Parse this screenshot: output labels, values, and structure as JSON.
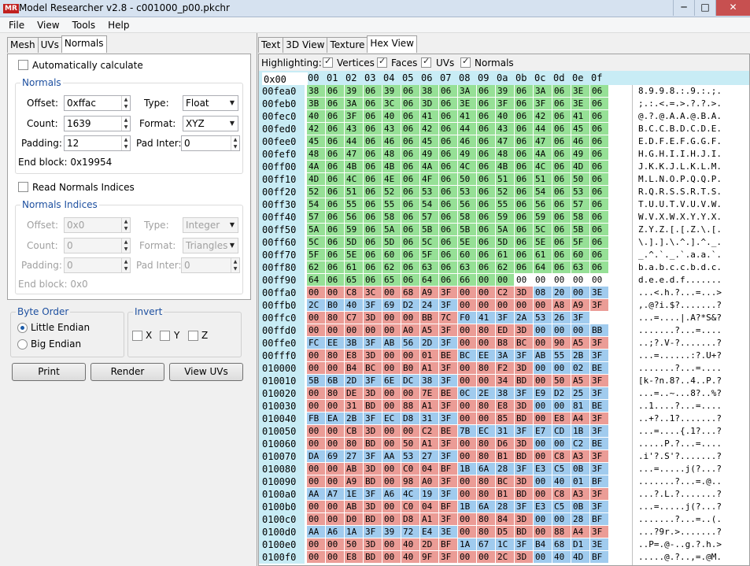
{
  "window": {
    "title": "Model Researcher v2.8 - c001000_p00.pkchr",
    "icon_text": "MR",
    "controls": [
      "─",
      "□",
      "✕"
    ]
  },
  "menu": [
    "File",
    "View",
    "Tools",
    "Help"
  ],
  "left_tabs": [
    "Mesh",
    "UVs",
    "Normals"
  ],
  "normals_tab": {
    "auto_calculate_label": "Automatically calculate",
    "auto_calculate_checked": false,
    "group_title": "Normals",
    "offset_label": "Offset:",
    "offset_value": "0xffac",
    "type_label": "Type:",
    "type_value": "Float",
    "count_label": "Count:",
    "count_value": "1639",
    "format_label": "Format:",
    "format_value": "XYZ",
    "padding_label": "Padding:",
    "padding_value": "12",
    "pad_inter_label": "Pad Inter:",
    "pad_inter_value": "0",
    "end_block_label": "End block: 0x19954",
    "read_indices_label": "Read Normals Indices",
    "read_indices_checked": false,
    "indices_group_title": "Normals Indices",
    "idx_offset_label": "Offset:",
    "idx_offset_value": "0x0",
    "idx_type_label": "Type:",
    "idx_type_value": "Integer",
    "idx_count_label": "Count:",
    "idx_count_value": "0",
    "idx_format_label": "Format:",
    "idx_format_value": "Triangles",
    "idx_padding_label": "Padding:",
    "idx_padding_value": "0",
    "idx_pad_inter_label": "Pad Inter:",
    "idx_pad_inter_value": "0",
    "idx_end_block_label": "End block: 0x0"
  },
  "byte_order": {
    "title": "Byte Order",
    "options": [
      "Little Endian",
      "Big Endian"
    ],
    "selected": "Little Endian"
  },
  "invert": {
    "title": "Invert",
    "options": [
      "X",
      "Y",
      "Z"
    ]
  },
  "buttons": [
    "Print",
    "Render",
    "View UVs"
  ],
  "right_tabs": [
    "Text",
    "3D View",
    "Texture",
    "Hex View"
  ],
  "active_right_tab": "Hex View",
  "highlighting": {
    "label": "Highlighting:",
    "options": [
      "Vertices",
      "Faces",
      "UVs",
      "Normals"
    ]
  },
  "hex_header": {
    "origin": "0x00",
    "columns": [
      "00",
      "01",
      "02",
      "03",
      "04",
      "05",
      "06",
      "07",
      "08",
      "09",
      "0a",
      "0b",
      "0c",
      "0d",
      "0e",
      "0f"
    ]
  },
  "hex_colors": {
    "g": "#96e096",
    "b": "#a0cbee",
    "r": "#eb9c96",
    "w": "#ffffff"
  },
  "hex_rows": [
    {
      "addr": "00fea0",
      "bytes": "38 06 39 06 39 06 38 06 3A 06 39 06 3A 06 3E 06",
      "colors": "gggggggggggggggg",
      "ascii": "8.9.9.8.:.9.:.;."
    },
    {
      "addr": "00feb0",
      "bytes": "3B 06 3A 06 3C 06 3D 06 3E 06 3F 06 3F 06 3E 06",
      "colors": "gggggggggggggggg",
      "ascii": ";.:.<.=.>.?.?.>."
    },
    {
      "addr": "00fec0",
      "bytes": "40 06 3F 06 40 06 41 06 41 06 40 06 42 06 41 06",
      "colors": "gggggggggggggggg",
      "ascii": "@.?.@.A.A.@.B.A."
    },
    {
      "addr": "00fed0",
      "bytes": "42 06 43 06 43 06 42 06 44 06 43 06 44 06 45 06",
      "colors": "gggggggggggggggg",
      "ascii": "B.C.C.B.D.C.D.E."
    },
    {
      "addr": "00fee0",
      "bytes": "45 06 44 06 46 06 45 06 46 06 47 06 47 06 46 06",
      "colors": "gggggggggggggggg",
      "ascii": "E.D.F.E.F.G.G.F."
    },
    {
      "addr": "00fef0",
      "bytes": "48 06 47 06 48 06 49 06 49 06 48 06 4A 06 49 06",
      "colors": "gggggggggggggggg",
      "ascii": "H.G.H.I.I.H.J.I."
    },
    {
      "addr": "00ff00",
      "bytes": "4A 06 4B 06 4B 06 4A 06 4C 06 4B 06 4C 06 4D 06",
      "colors": "gggggggggggggggg",
      "ascii": "J.K.K.J.L.K.L.M."
    },
    {
      "addr": "00ff10",
      "bytes": "4D 06 4C 06 4E 06 4F 06 50 06 51 06 51 06 50 06",
      "colors": "gggggggggggggggg",
      "ascii": "M.L.N.O.P.Q.Q.P."
    },
    {
      "addr": "00ff20",
      "bytes": "52 06 51 06 52 06 53 06 53 06 52 06 54 06 53 06",
      "colors": "gggggggggggggggg",
      "ascii": "R.Q.R.S.S.R.T.S."
    },
    {
      "addr": "00ff30",
      "bytes": "54 06 55 06 55 06 54 06 56 06 55 06 56 06 57 06",
      "colors": "gggggggggggggggg",
      "ascii": "T.U.U.T.V.U.V.W."
    },
    {
      "addr": "00ff40",
      "bytes": "57 06 56 06 58 06 57 06 58 06 59 06 59 06 58 06",
      "colors": "gggggggggggggggg",
      "ascii": "W.V.X.W.X.Y.Y.X."
    },
    {
      "addr": "00ff50",
      "bytes": "5A 06 59 06 5A 06 5B 06 5B 06 5A 06 5C 06 5B 06",
      "colors": "gggggggggggggggg",
      "ascii": "Z.Y.Z.[.[.Z.\\.[."
    },
    {
      "addr": "00ff60",
      "bytes": "5C 06 5D 06 5D 06 5C 06 5E 06 5D 06 5E 06 5F 06",
      "colors": "gggggggggggggggg",
      "ascii": "\\.].].\\.^.].^._."
    },
    {
      "addr": "00ff70",
      "bytes": "5F 06 5E 06 60 06 5F 06 60 06 61 06 61 06 60 06",
      "colors": "gggggggggggggggg",
      "ascii": "_.^.`._.`.a.a.`."
    },
    {
      "addr": "00ff80",
      "bytes": "62 06 61 06 62 06 63 06 63 06 62 06 64 06 63 06",
      "colors": "gggggggggggggggg",
      "ascii": "b.a.b.c.c.b.d.c."
    },
    {
      "addr": "00ff90",
      "bytes": "64 06 65 06 65 06 64 06 66 00 00 00 00 00 00 00",
      "colors": "gggggggggggwwwww",
      "ascii": "d.e.e.d.f......."
    },
    {
      "addr": "00ffa0",
      "bytes": "00 00 C8 3C 00 68 A9 3F 00 00 C2 3D 08 20 00 3E",
      "colors": "rrrrrrrrrrrrbbbb",
      "ascii": "...<.h.?...=...>"
    },
    {
      "addr": "00ffb0",
      "bytes": "2C B0 40 3F 69 D2 24 3F 00 00 00 00 00 A8 A9 3F",
      "colors": "bbbbbbbbrrrrrrrr",
      "ascii": ",.@?i.$?.......?"
    },
    {
      "addr": "00ffc0",
      "bytes": "00 80 C7 3D 00 00 BB 7C F0 41 3F 2A 53 26 3F",
      "colors": "rrrrrrrrbbbbbbbb",
      "ascii": "...=....|.A?*S&?"
    },
    {
      "addr": "00ffd0",
      "bytes": "00 00 00 00 00 A0 A5 3F 00 80 ED 3D 00 00 00 BB",
      "colors": "rrrrrrrrrrrrbbbb",
      "ascii": ".......?...=...."
    },
    {
      "addr": "00ffe0",
      "bytes": "FC EE 3B 3F AB 56 2D 3F 00 00 B8 BC 00 90 A5 3F",
      "colors": "bbbbbbbbrrrrrrrr",
      "ascii": "..;?.V-?.......?"
    },
    {
      "addr": "00fff0",
      "bytes": "00 80 E8 3D 00 00 01 BE BC EE 3A 3F AB 55 2B 3F",
      "colors": "rrrrrrrrbbbbbbbb",
      "ascii": "...=......:?.U+?"
    },
    {
      "addr": "010000",
      "bytes": "00 00 B4 BC 00 B0 A1 3F 00 80 F2 3D 00 00 02 BE",
      "colors": "rrrrrrrrrrrrbbbb",
      "ascii": ".......?...=...."
    },
    {
      "addr": "010010",
      "bytes": "5B 6B 2D 3F 6E DC 38 3F 00 00 34 BD 00 50 A5 3F",
      "colors": "bbbbbbbbrrrrrrrr",
      "ascii": "[k-?n.8?..4..P.?"
    },
    {
      "addr": "010020",
      "bytes": "00 80 DE 3D 00 00 7E BE 0C 2E 38 3F E9 D2 25 3F",
      "colors": "rrrrrrrrbbbbbbbb",
      "ascii": "...=..~...8?..%?"
    },
    {
      "addr": "010030",
      "bytes": "00 00 31 BD 00 88 A1 3F 00 80 E8 3D 00 00 81 BE",
      "colors": "rrrrrrrrrrrrbbbb",
      "ascii": "..1....?...=...."
    },
    {
      "addr": "010040",
      "bytes": "FB EA 2B 3F EC D8 31 3F 00 00 85 BD 00 E8 A4 3F",
      "colors": "bbbbbbbbrrrrrrrr",
      "ascii": "..+?..1?.......?"
    },
    {
      "addr": "010050",
      "bytes": "00 00 CB 3D 00 00 C2 BE 7B EC 31 3F E7 CD 1B 3F",
      "colors": "rrrrrrrrbbbbbbbb",
      "ascii": "...=....{.1?...?"
    },
    {
      "addr": "010060",
      "bytes": "00 00 80 BD 00 50 A1 3F 00 80 D6 3D 00 00 C2 BE",
      "colors": "rrrrrrrrrrrrbbbb",
      "ascii": ".....P.?...=...."
    },
    {
      "addr": "010070",
      "bytes": "DA 69 27 3F AA 53 27 3F 00 80 B1 BD 00 C8 A3 3F",
      "colors": "bbbbbbbbrrrrrrrr",
      "ascii": ".i'?.S'?.......?"
    },
    {
      "addr": "010080",
      "bytes": "00 00 AB 3D 00 C0 04 BF 1B 6A 28 3F E3 C5 0B 3F",
      "colors": "rrrrrrrrbbbbbbbb",
      "ascii": "...=.....j(?...?"
    },
    {
      "addr": "010090",
      "bytes": "00 00 A9 BD 00 98 A0 3F 00 80 BC 3D 00 40 01 BF",
      "colors": "rrrrrrrrrrrrbbbb",
      "ascii": ".......?...=.@.."
    },
    {
      "addr": "0100a0",
      "bytes": "AA A7 1E 3F A6 4C 19 3F 00 80 B1 BD 00 C8 A3 3F",
      "colors": "bbbbbbbbrrrrrrrr",
      "ascii": "...?.L.?.......?"
    },
    {
      "addr": "0100b0",
      "bytes": "00 00 AB 3D 00 C0 04 BF 1B 6A 28 3F E3 C5 0B 3F",
      "colors": "rrrrrrrrbbbbbbbb",
      "ascii": "...=.....j(?...?"
    },
    {
      "addr": "0100c0",
      "bytes": "00 00 D0 BD 00 D8 A1 3F 00 80 84 3D 00 00 28 BF",
      "colors": "rrrrrrrrrrrrbbbb",
      "ascii": ".......?...=..(."
    },
    {
      "addr": "0100d0",
      "bytes": "AA A6 1A 3F 39 72 E4 3E 00 80 D5 BD 00 88 A4 3F",
      "colors": "bbbbbbbbrrrrrrrr",
      "ascii": "...?9r.>.......?"
    },
    {
      "addr": "0100e0",
      "bytes": "00 00 50 3D 00 40 2D BF 1A 67 1C 3F B4 68 D1 3E",
      "colors": "rrrrrrrrbbbbbbbb",
      "ascii": "..P=.@-..g.?.h.>"
    },
    {
      "addr": "0100f0",
      "bytes": "00 00 E8 BD 00 40 9F 3F 00 00 2C 3D 00 40 4D BF",
      "colors": "rrrrrrrrrrrrbbbb",
      "ascii": ".....@.?..,=.@M."
    }
  ]
}
